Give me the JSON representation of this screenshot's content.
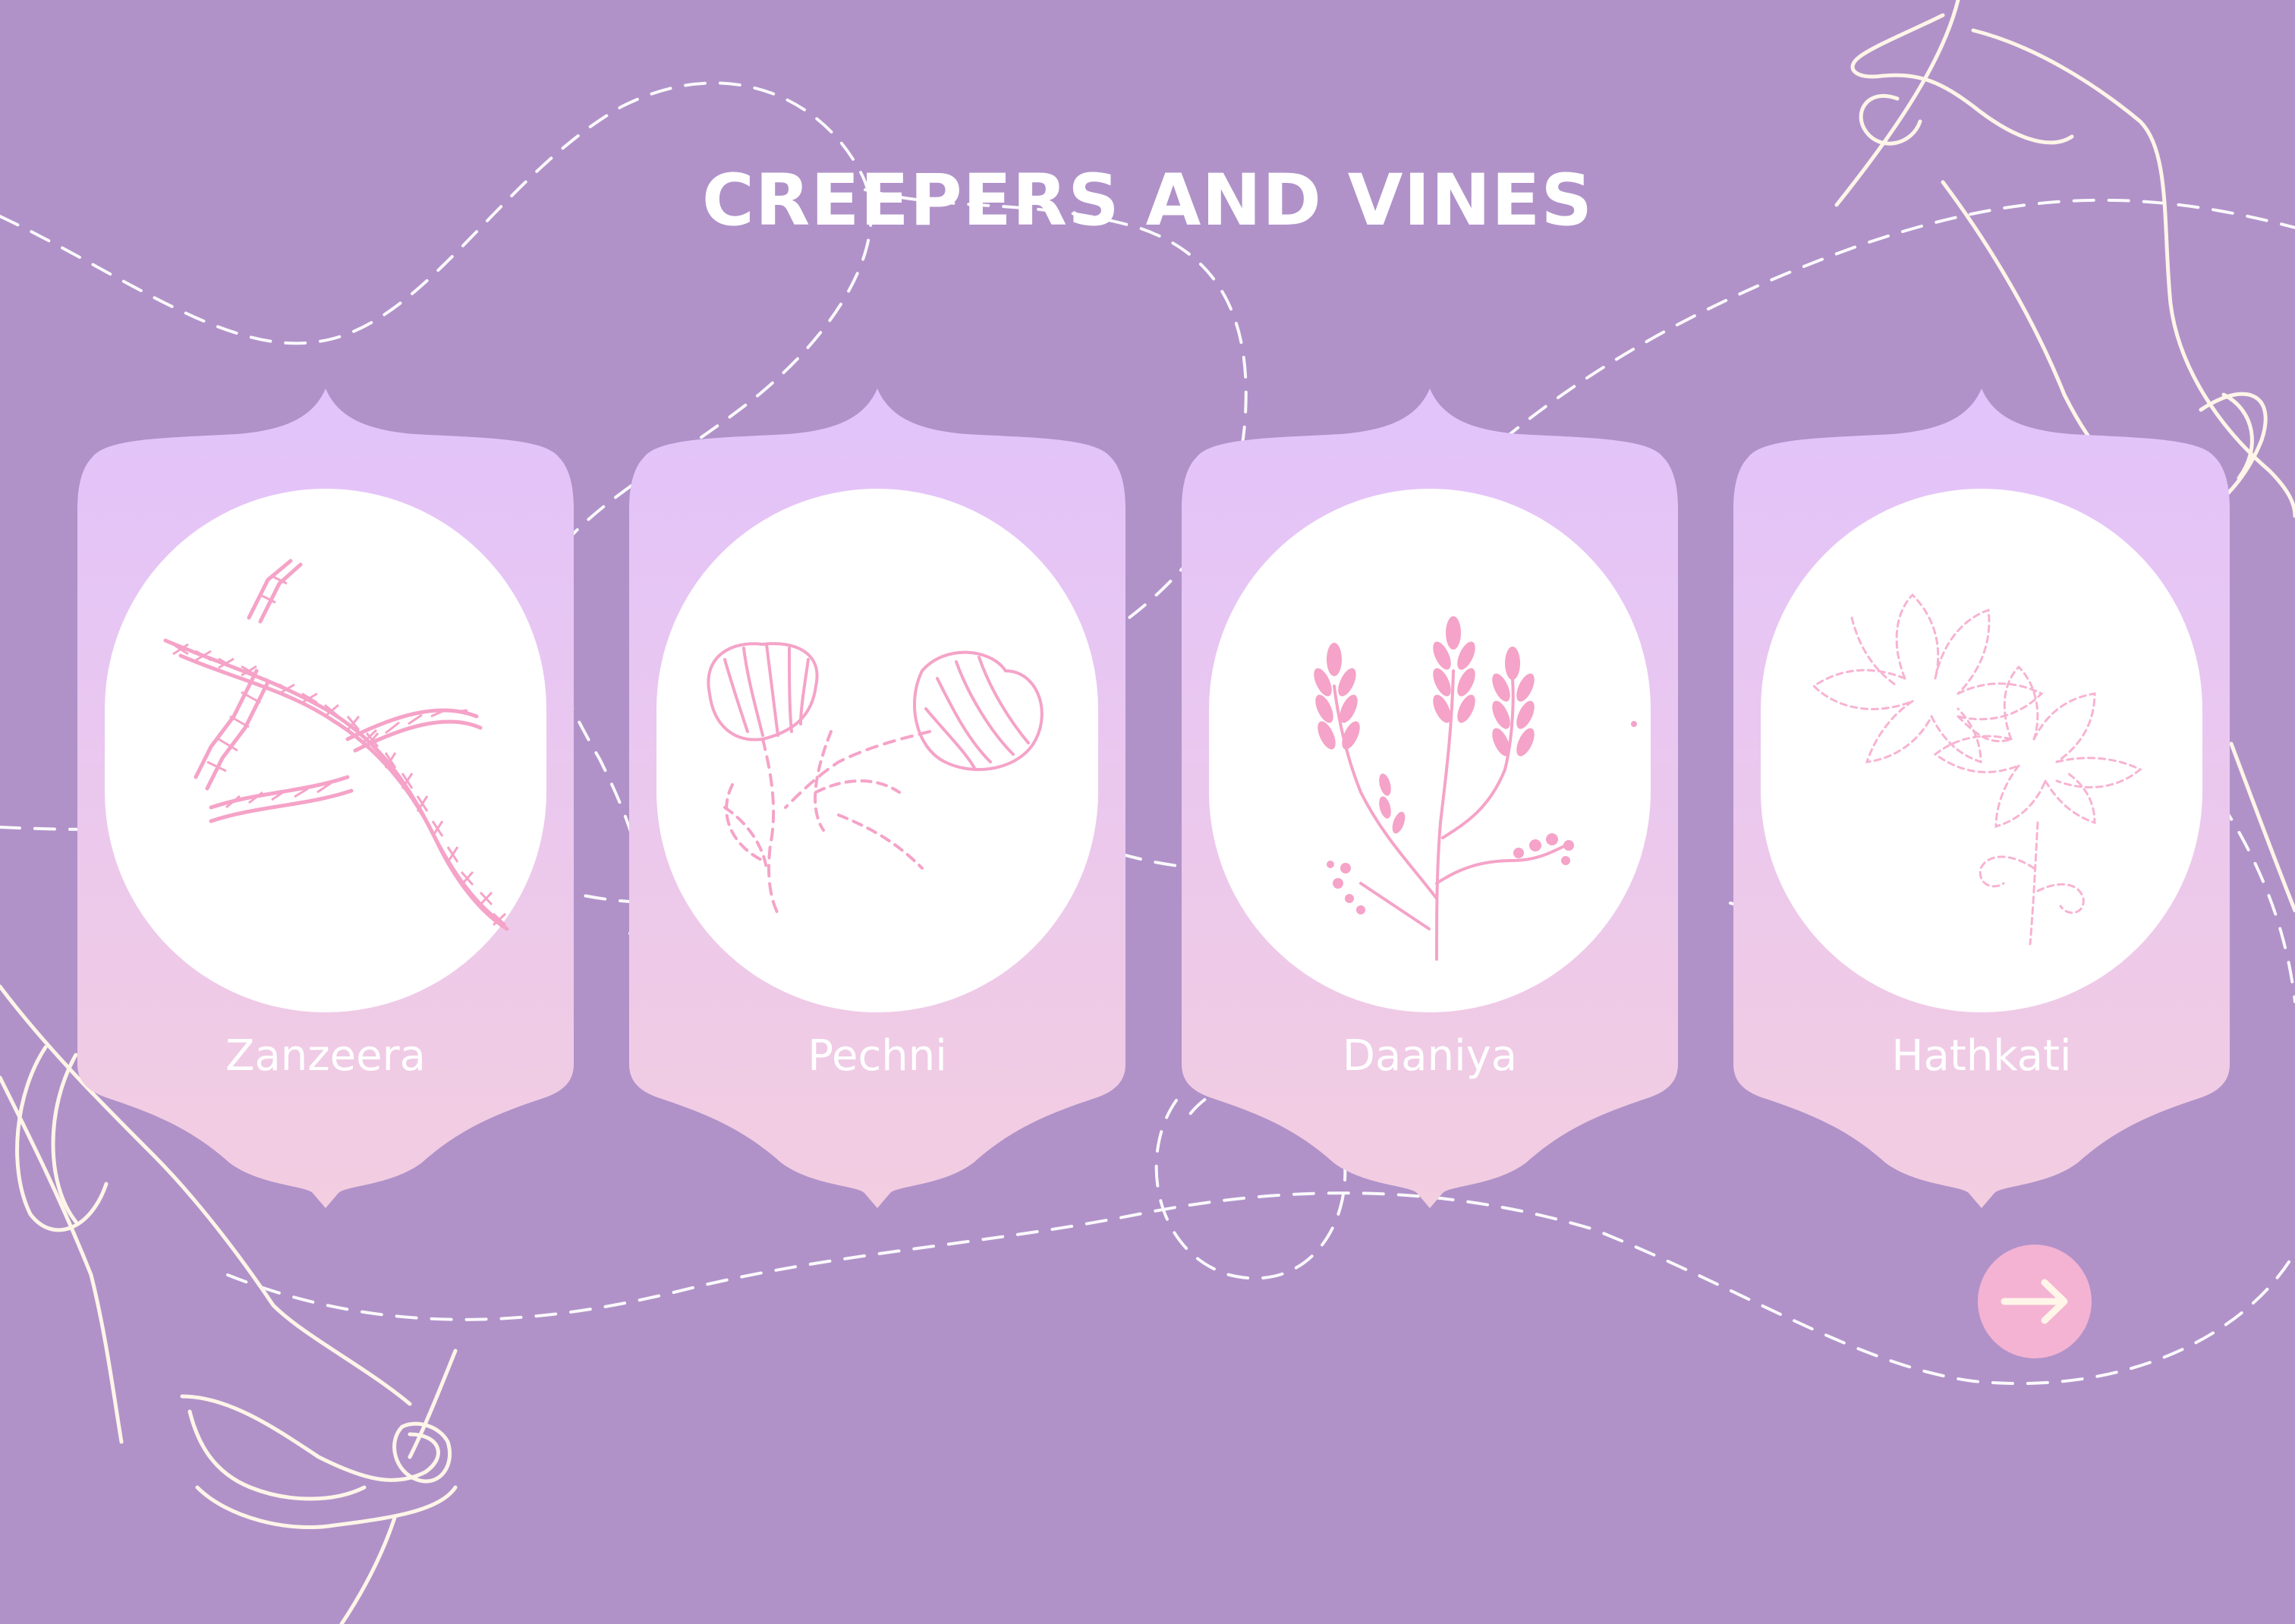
{
  "page": {
    "title": "CREEPERS AND VINES"
  },
  "cards": [
    {
      "label": "Zanzeera",
      "icon": "zanzeera-stitch-icon"
    },
    {
      "label": "Pechni",
      "icon": "pechni-flower-icon"
    },
    {
      "label": "Daaniya",
      "icon": "daaniya-wheat-icon"
    },
    {
      "label": "Hathkati",
      "icon": "hathkati-lotus-icon"
    }
  ],
  "navigation": {
    "next_icon": "arrow-right-icon"
  },
  "colors": {
    "background": "#b092c9",
    "card_top": "#e2c3fb",
    "card_bottom": "#f3cde0",
    "motif": "#f5a3c8",
    "accent_button": "#f4b3d3",
    "line_art": "#fff5e8"
  }
}
